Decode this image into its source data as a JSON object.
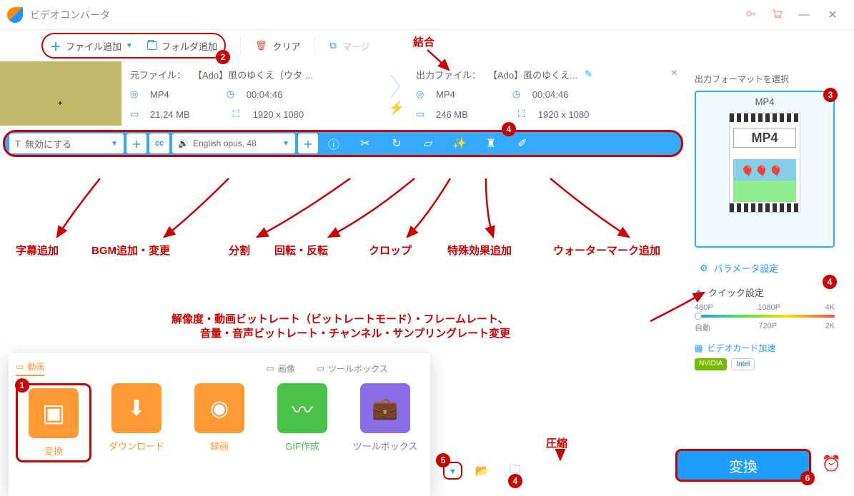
{
  "app": {
    "title": "ビデオコンバータ"
  },
  "toolbar": {
    "add_file": "ファイル追加",
    "add_folder": "フォルダ追加",
    "clear": "クリア",
    "merge": "マージ"
  },
  "file": {
    "source_label": "元ファイル：",
    "source_name": "【Ado】風のゆくえ（ウタ ...",
    "output_label": "出力ファイル：",
    "output_name": "【Ado】風のゆくえ...",
    "format": "MP4",
    "duration": "00:04:46",
    "src_size": "21.24 MB",
    "out_size": "246 MB",
    "src_res": "1920 x 1080",
    "out_res": "1920 x 1080"
  },
  "edit_bar": {
    "subtitle_disable": "無効にする",
    "audio_track": "English opus, 48",
    "cc": "cc"
  },
  "sidebar": {
    "output_format_label": "出力フォーマットを選択",
    "format": "MP4",
    "format_big": "MP4",
    "param": "パラメータ設定",
    "quick": "クイック設定",
    "res": {
      "p480": "480P",
      "p1080": "1080P",
      "p4k": "4K",
      "auto": "自動",
      "p720": "720P",
      "p2k": "2K"
    },
    "gpu": "ビデオカード加速",
    "nvidia": "NVIDIA",
    "intel": "Intel"
  },
  "annotations": {
    "merge_top": "結合",
    "subtitle": "字幕追加",
    "bgm": "BGM追加・変更",
    "split": "分割",
    "rotate": "回転・反転",
    "crop": "クロップ",
    "effect": "特殊効果追加",
    "watermark": "ウォーターマーク追加",
    "param_line1": "解像度・動画ビットレート（ビットレートモード）・フレームレート、",
    "param_line2": "音量・音声ビットレート・チャンネル・サンプリングレート変更",
    "compress": "圧縮"
  },
  "bottom": {
    "tab_video": "動画",
    "tab_image": "画像",
    "tab_toolbox": "ツールボックス",
    "cat_convert": "変換",
    "cat_download": "ダウンロード",
    "cat_record": "録画",
    "cat_gif": "GIF作成",
    "cat_toolbox": "ツールボックス",
    "convert_btn": "変換"
  }
}
